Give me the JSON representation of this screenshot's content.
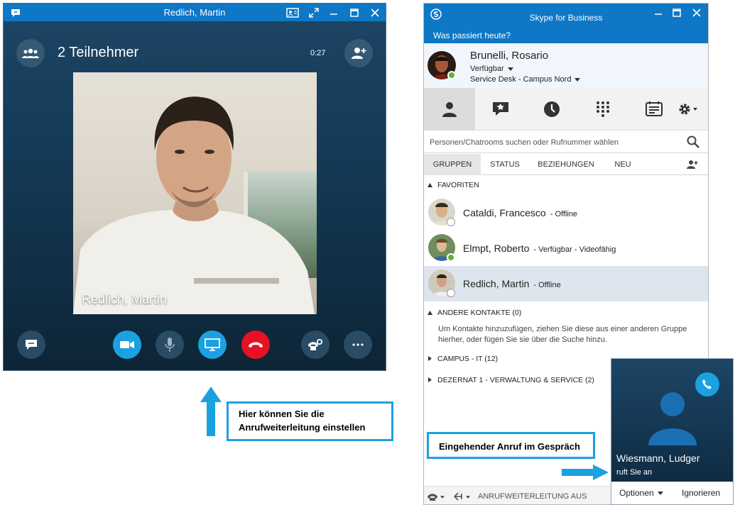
{
  "call_window": {
    "title": "Redlich, Martin",
    "participants_label": "2 Teilnehmer",
    "timer": "0:27",
    "video_name": "Redlich, Martin",
    "colors": {
      "titlebar": "#0e77c6",
      "accent": "#1ba1e2",
      "hangup": "#e81123"
    }
  },
  "callouts": {
    "forwarding_line1": "Hier können Sie die",
    "forwarding_line2": "Anrufweiterleitung einstellen",
    "incoming": "Eingehender Anruf im Gespräch"
  },
  "skype": {
    "title": "Skype for Business",
    "whats_happening": "Was passiert heute?",
    "user": {
      "name": "Brunelli, Rosario",
      "status": "Verfügbar",
      "location": "Service Desk - Campus Nord"
    },
    "search_placeholder": "Personen/Chatrooms suchen oder Rufnummer wählen",
    "filters": [
      "GRUPPEN",
      "STATUS",
      "BEZIEHUNGEN",
      "NEU"
    ],
    "groups": {
      "favorites": "FAVORITEN",
      "other_contacts": "ANDERE KONTAKTE (0)",
      "campus_it": "CAMPUS - IT (12)",
      "dezernat": "DEZERNAT 1 - VERWALTUNG & SERVICE (2)"
    },
    "contacts": [
      {
        "name": "Cataldi, Francesco",
        "status": "- Offline"
      },
      {
        "name": "Elmpt, Roberto",
        "status": "- Verfügbar - Videofähig"
      },
      {
        "name": "Redlich, Martin",
        "status": "- Offline"
      }
    ],
    "hint_text": "Um Kontakte hinzuzufügen, ziehen Sie diese aus einer anderen Gruppe hierher, oder fügen Sie sie über die Suche hinzu.",
    "footer_forwarding": "ANRUFWEITERLEITUNG AUS"
  },
  "toast": {
    "caller": "Wiesmann, Ludger",
    "calling": "ruft Sie an",
    "options": "Optionen",
    "ignore": "Ignorieren"
  }
}
